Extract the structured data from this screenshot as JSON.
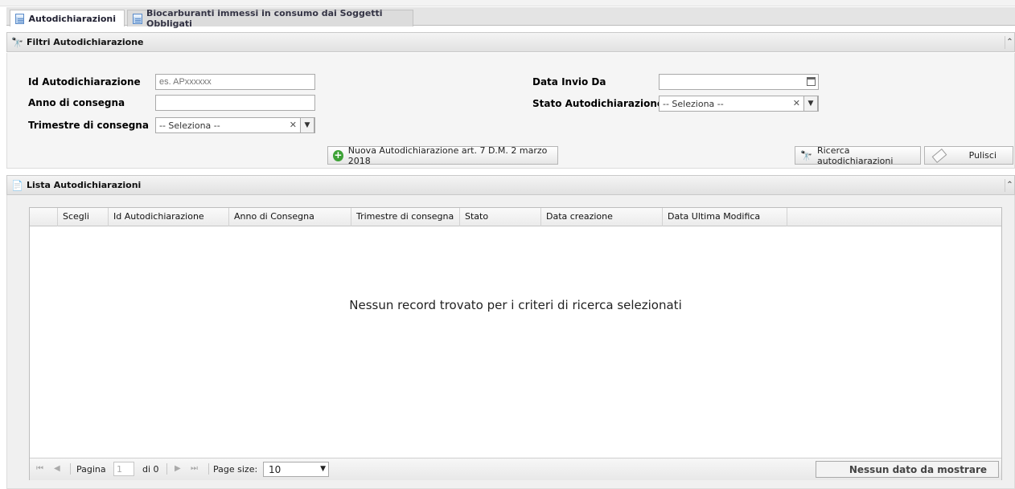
{
  "tabs": [
    {
      "label": "Autodichiarazioni",
      "active": true
    },
    {
      "label": "Biocarburanti immessi in consumo dai Soggetti Obbligati",
      "active": false
    }
  ],
  "filters": {
    "title": "Filtri Autodichiarazione",
    "id_label": "Id Autodichiarazione",
    "id_placeholder": "es. APxxxxxx",
    "anno_label": "Anno di consegna",
    "anno_value": "",
    "trimestre_label": "Trimestre di consegna",
    "trimestre_value": "-- Seleziona --",
    "data_invio_label": "Data Invio Da",
    "data_invio_value": "",
    "stato_label": "Stato Autodichiarazione",
    "stato_value": "-- Seleziona --",
    "new_button": "Nuova Autodichiarazione art. 7 D.M. 2 marzo 2018",
    "search_button": "Ricerca autodichiarazioni",
    "clear_button": "Pulisci"
  },
  "list": {
    "title": "Lista Autodichiarazioni",
    "columns": [
      "Scegli",
      "Id Autodichiarazione",
      "Anno di Consegna",
      "Trimestre di consegna",
      "Stato",
      "Data creazione",
      "Data Ultima Modifica"
    ],
    "empty_message": "Nessun record trovato per i criteri di ricerca selezionati"
  },
  "pager": {
    "page_label": "Pagina",
    "page_value": "1",
    "of_label": "di 0",
    "page_size_label": "Page size:",
    "page_size_value": "10",
    "status": "Nessun dato da mostrare"
  },
  "icons": {
    "tab": "grid-icon",
    "filters": "binoculars-icon",
    "list": "list-icon",
    "collapse": "double-chevron-up-icon"
  }
}
